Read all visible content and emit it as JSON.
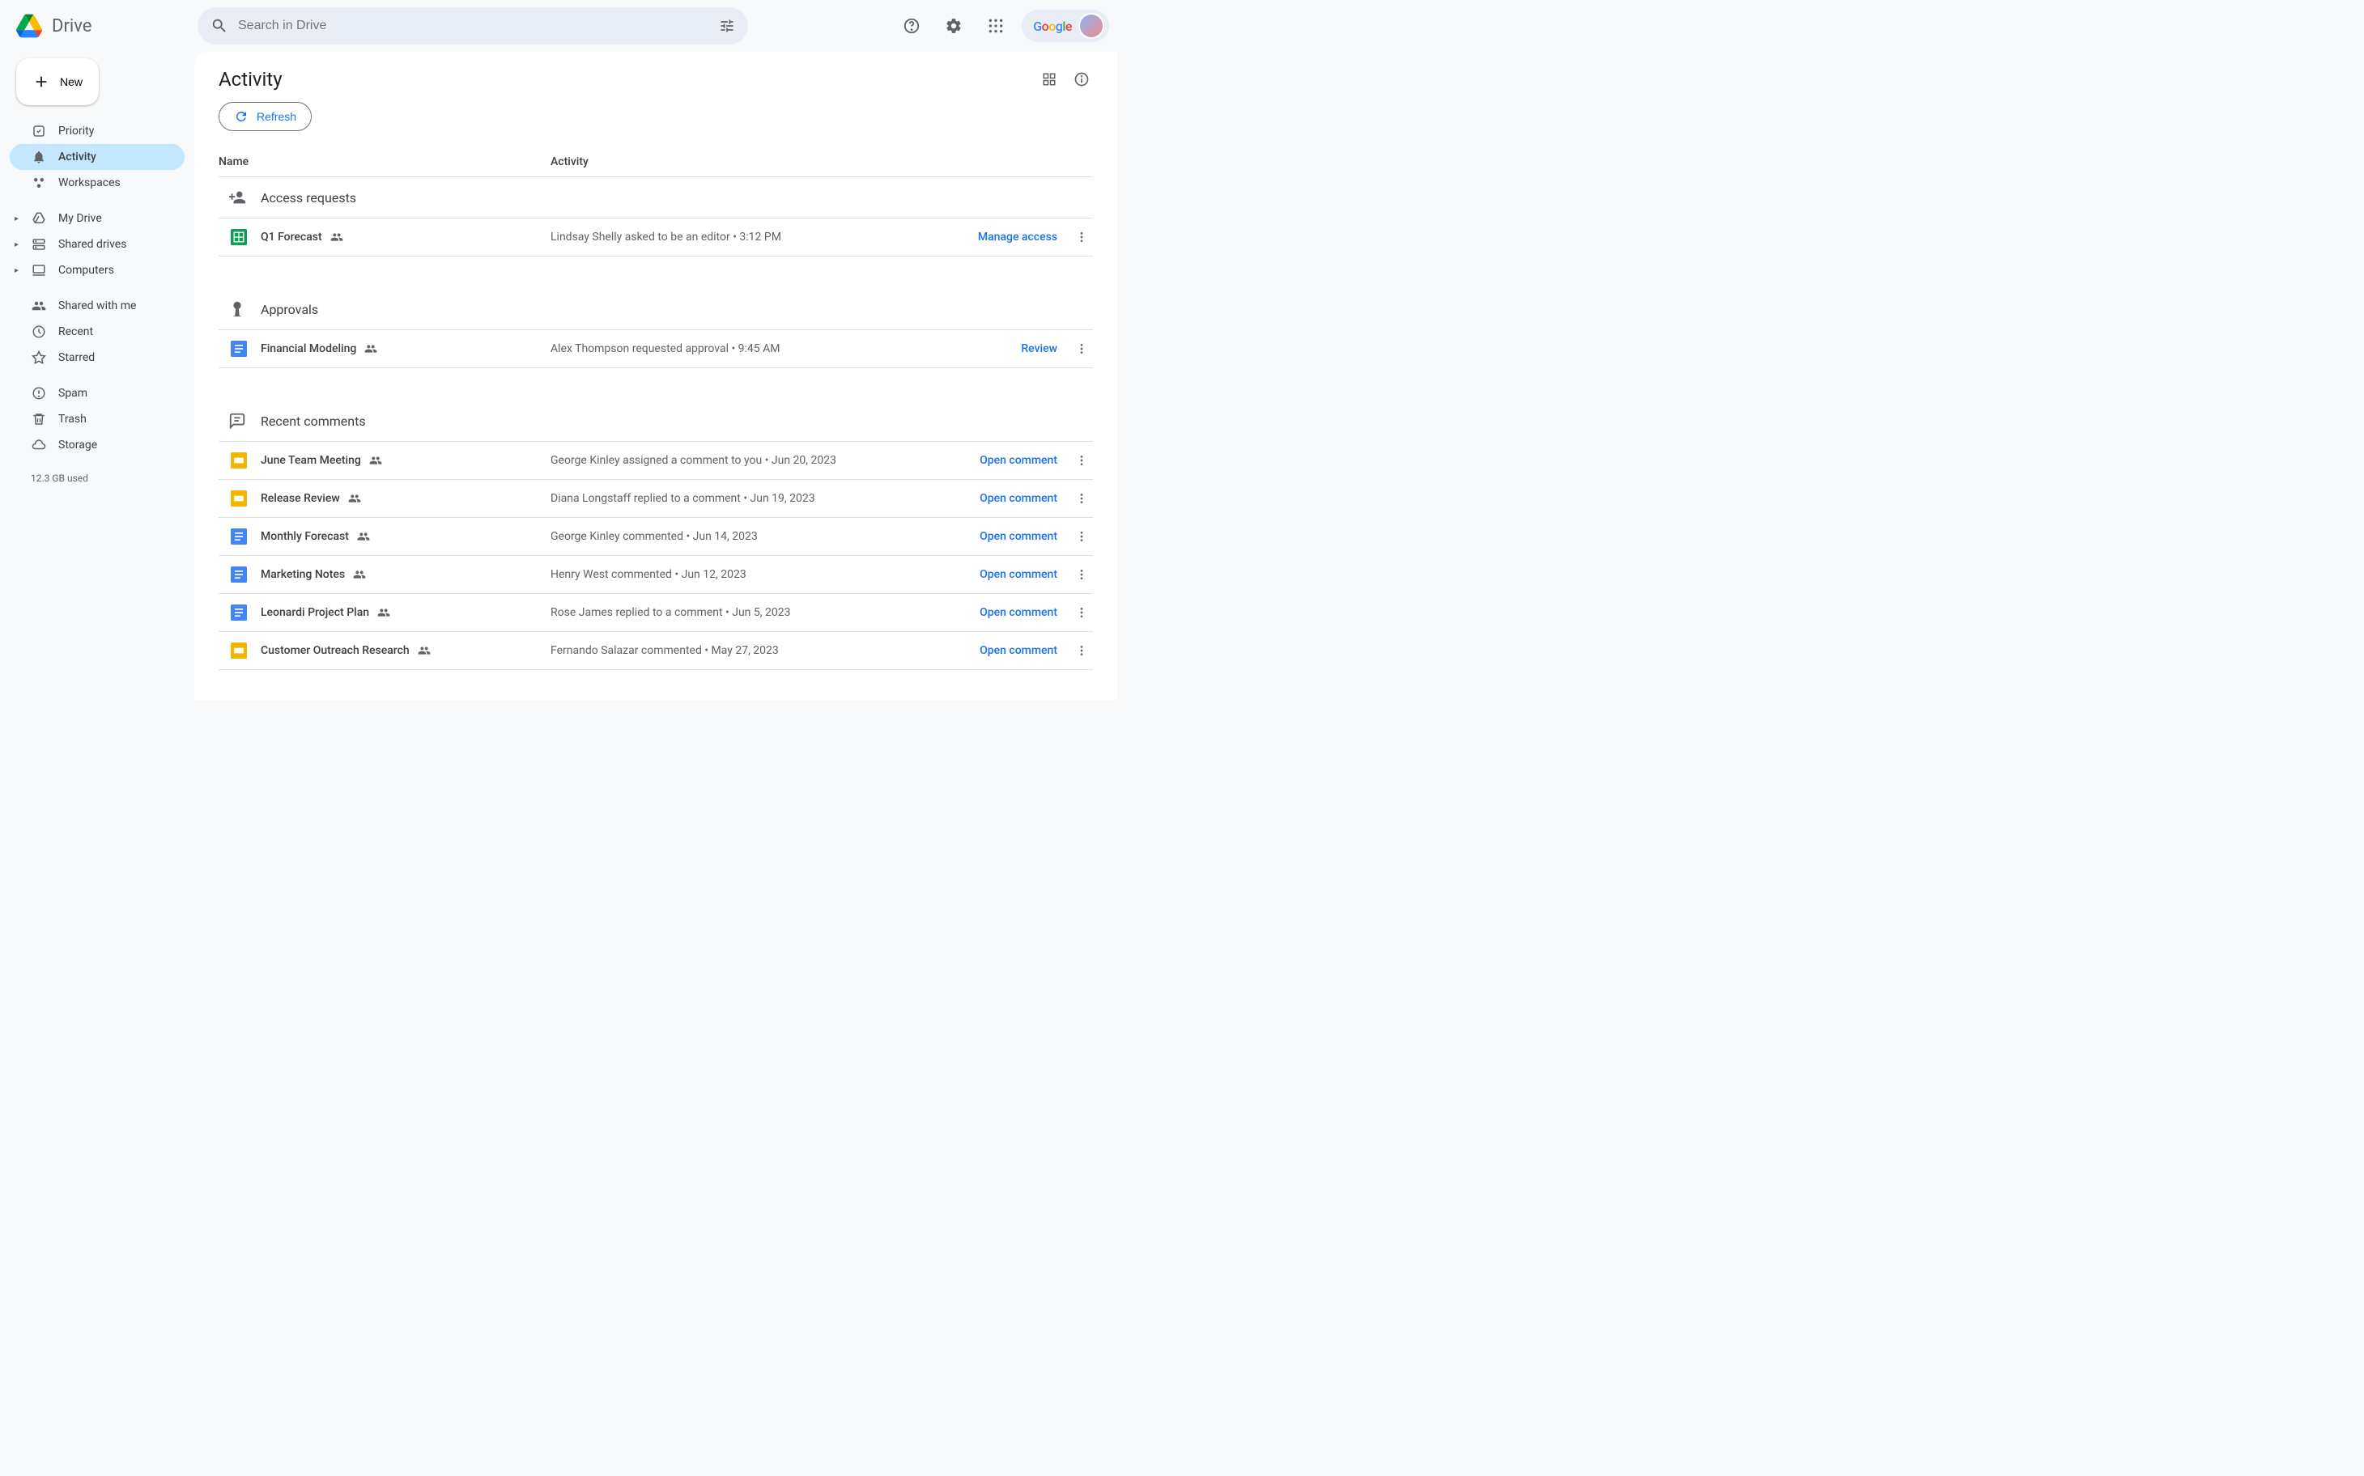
{
  "header": {
    "app_name": "Drive",
    "search_placeholder": "Search in Drive"
  },
  "sidebar": {
    "new_label": "New",
    "groups": [
      [
        {
          "icon": "priority",
          "label": "Priority",
          "active": false,
          "expandable": false
        },
        {
          "icon": "activity",
          "label": "Activity",
          "active": true,
          "expandable": false
        },
        {
          "icon": "workspaces",
          "label": "Workspaces",
          "active": false,
          "expandable": false
        }
      ],
      [
        {
          "icon": "mydrive",
          "label": "My Drive",
          "active": false,
          "expandable": true
        },
        {
          "icon": "shareddrives",
          "label": "Shared drives",
          "active": false,
          "expandable": true
        },
        {
          "icon": "computers",
          "label": "Computers",
          "active": false,
          "expandable": true
        }
      ],
      [
        {
          "icon": "sharedwithme",
          "label": "Shared with me",
          "active": false,
          "expandable": false
        },
        {
          "icon": "recent",
          "label": "Recent",
          "active": false,
          "expandable": false
        },
        {
          "icon": "starred",
          "label": "Starred",
          "active": false,
          "expandable": false
        }
      ],
      [
        {
          "icon": "spam",
          "label": "Spam",
          "active": false,
          "expandable": false
        },
        {
          "icon": "trash",
          "label": "Trash",
          "active": false,
          "expandable": false
        },
        {
          "icon": "storage",
          "label": "Storage",
          "active": false,
          "expandable": false
        }
      ]
    ],
    "storage_used": "12.3 GB used"
  },
  "page": {
    "title": "Activity",
    "refresh_label": "Refresh",
    "col_name": "Name",
    "col_activity": "Activity"
  },
  "sections": [
    {
      "icon": "access",
      "title": "Access requests",
      "rows": [
        {
          "file_type": "sheets",
          "name": "Q1 Forecast",
          "shared": true,
          "activity": "Lindsay Shelly asked to be an editor • 3:12 PM",
          "action": "Manage access"
        }
      ]
    },
    {
      "icon": "approvals",
      "title": "Approvals",
      "rows": [
        {
          "file_type": "docs",
          "name": "Financial Modeling",
          "shared": true,
          "activity": "Alex Thompson requested approval • 9:45 AM",
          "action": "Review"
        }
      ]
    },
    {
      "icon": "comments",
      "title": "Recent comments",
      "rows": [
        {
          "file_type": "slides",
          "name": "June Team Meeting",
          "shared": true,
          "activity": "George Kinley assigned a comment to you • Jun 20, 2023",
          "action": "Open comment"
        },
        {
          "file_type": "slides",
          "name": "Release Review",
          "shared": true,
          "activity": "Diana Longstaff replied to a comment • Jun 19, 2023",
          "action": "Open comment"
        },
        {
          "file_type": "docs",
          "name": "Monthly Forecast",
          "shared": true,
          "activity": "George Kinley commented • Jun 14, 2023",
          "action": "Open comment"
        },
        {
          "file_type": "docs",
          "name": "Marketing Notes",
          "shared": true,
          "activity": "Henry West commented • Jun 12, 2023",
          "action": "Open comment"
        },
        {
          "file_type": "docs",
          "name": "Leonardi Project Plan",
          "shared": true,
          "activity": "Rose James replied to a comment • Jun 5, 2023",
          "action": "Open comment"
        },
        {
          "file_type": "slides",
          "name": "Customer Outreach Research",
          "shared": true,
          "activity": "Fernando Salazar commented • May 27, 2023",
          "action": "Open comment"
        }
      ]
    }
  ]
}
